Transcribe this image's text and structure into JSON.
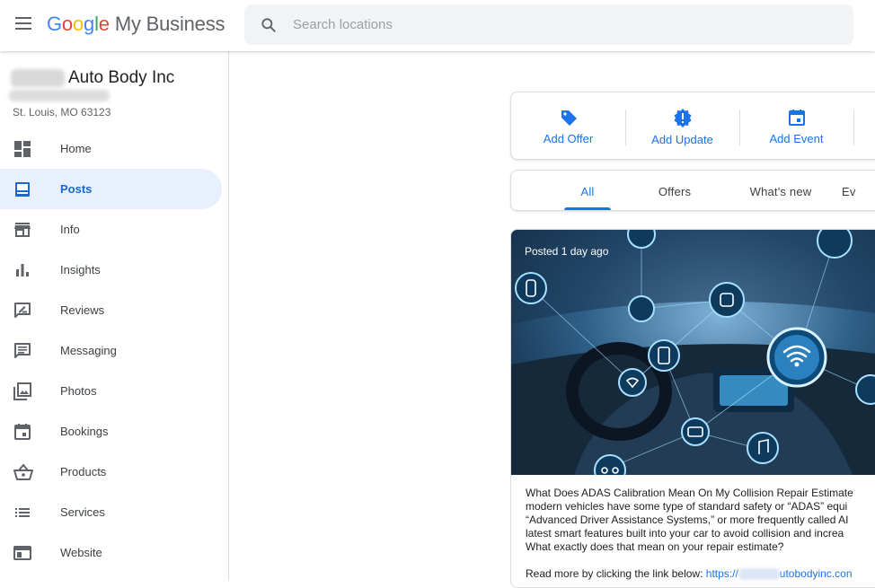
{
  "header": {
    "logo_google": [
      "G",
      "o",
      "o",
      "g",
      "l",
      "e"
    ],
    "logo_colors": [
      "#4285F4",
      "#EA4335",
      "#FBBC05",
      "#4285F4",
      "#34A853",
      "#EA4335"
    ],
    "logo_product": "My Business",
    "search_placeholder": "Search locations"
  },
  "business": {
    "name_visible": "Auto Body Inc",
    "address": "St. Louis, MO 63123"
  },
  "nav": {
    "items": [
      {
        "label": "Home",
        "icon": "dashboard-icon"
      },
      {
        "label": "Posts",
        "icon": "posts-icon",
        "active": true
      },
      {
        "label": "Info",
        "icon": "storefront-icon"
      },
      {
        "label": "Insights",
        "icon": "bar-chart-icon"
      },
      {
        "label": "Reviews",
        "icon": "reviews-icon"
      },
      {
        "label": "Messaging",
        "icon": "message-icon"
      },
      {
        "label": "Photos",
        "icon": "photos-icon"
      },
      {
        "label": "Bookings",
        "icon": "calendar-icon"
      },
      {
        "label": "Products",
        "icon": "basket-icon"
      },
      {
        "label": "Services",
        "icon": "list-icon"
      },
      {
        "label": "Website",
        "icon": "website-icon"
      }
    ]
  },
  "actions": [
    {
      "label": "Add Offer",
      "icon": "tag-icon"
    },
    {
      "label": "Add Update",
      "icon": "update-badge-icon"
    },
    {
      "label": "Add Event",
      "icon": "event-icon"
    }
  ],
  "tabs": [
    {
      "label": "All",
      "active": true
    },
    {
      "label": "Offers"
    },
    {
      "label": "What's new"
    },
    {
      "label": "Ev"
    }
  ],
  "post": {
    "posted": "Posted 1 day ago",
    "text_lines": [
      "What Does ADAS Calibration Mean On My Collision Repair Estimate",
      "modern vehicles have some type of standard safety or “ADAS” equi",
      "“Advanced Driver Assistance Systems,” or more frequently called AI",
      "latest smart features built into your car to avoid collision and increa",
      "What exactly does that mean on your repair estimate?"
    ],
    "read_more": "Read more by clicking the link below: ",
    "link_prefix": "https://",
    "link_suffix": "utobodyinc.con"
  },
  "colors": {
    "accent": "#1a73e8",
    "active_nav_bg": "#e8f0fe",
    "active_nav_text": "#1967d2"
  }
}
